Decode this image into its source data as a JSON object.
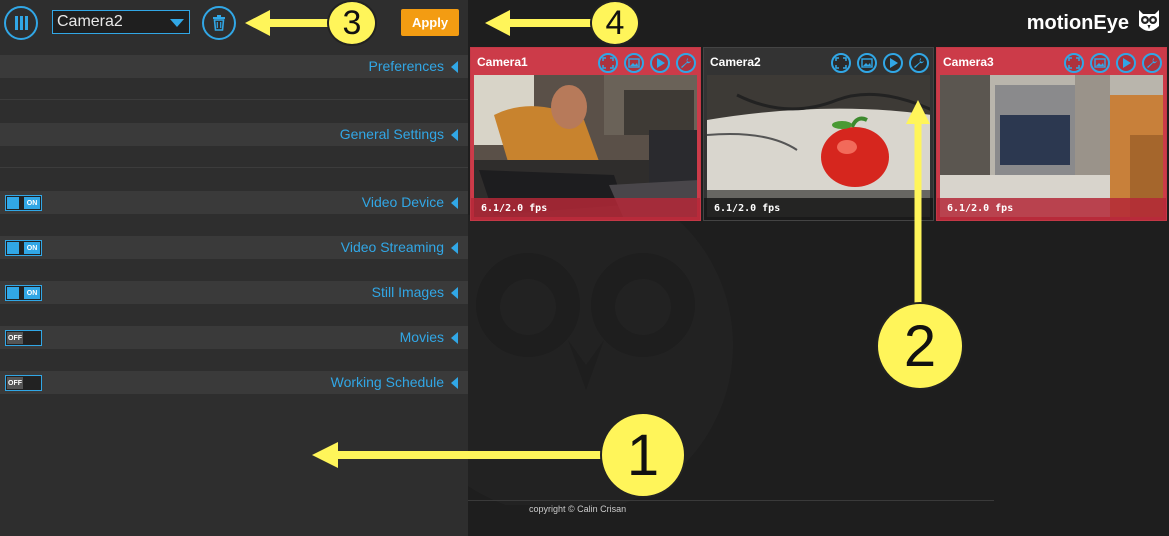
{
  "header": {
    "menu_icon": "menu-columns-icon",
    "camera_select": {
      "value": "Camera2"
    },
    "delete_icon": "trash-icon",
    "apply_label": "Apply",
    "brand": "motionEye",
    "brand_icon": "owl-icon"
  },
  "settings_sections": [
    {
      "label": "Preferences",
      "toggle": null
    },
    {
      "label": "General Settings",
      "toggle": null
    },
    {
      "label": "Video Device",
      "toggle": "ON"
    },
    {
      "label": "Video Streaming",
      "toggle": "ON"
    },
    {
      "label": "Still Images",
      "toggle": "ON"
    },
    {
      "label": "Movies",
      "toggle": "OFF"
    },
    {
      "label": "Working Schedule",
      "toggle": "OFF"
    }
  ],
  "cameras": [
    {
      "name": "Camera1",
      "fps": "6.1/2.0 fps",
      "icons": [
        "fullscreen-icon",
        "pictures-icon",
        "play-icon",
        "wrench-icon"
      ]
    },
    {
      "name": "Camera2",
      "fps": "6.1/2.0 fps",
      "icons": [
        "fullscreen-icon",
        "pictures-icon",
        "play-icon",
        "wrench-icon"
      ]
    },
    {
      "name": "Camera3",
      "fps": "6.1/2.0 fps",
      "icons": [
        "fullscreen-icon",
        "pictures-icon",
        "play-icon",
        "wrench-icon"
      ]
    }
  ],
  "footer": {
    "copyright": "copyright © Calin Crisan"
  },
  "annotations": [
    {
      "number": "1"
    },
    {
      "number": "2"
    },
    {
      "number": "3"
    },
    {
      "number": "4"
    }
  ],
  "colors": {
    "accent": "#31a7e6",
    "apply": "#f39c12",
    "camera_frame": "#cc3b49",
    "annotation": "#fff55a"
  }
}
